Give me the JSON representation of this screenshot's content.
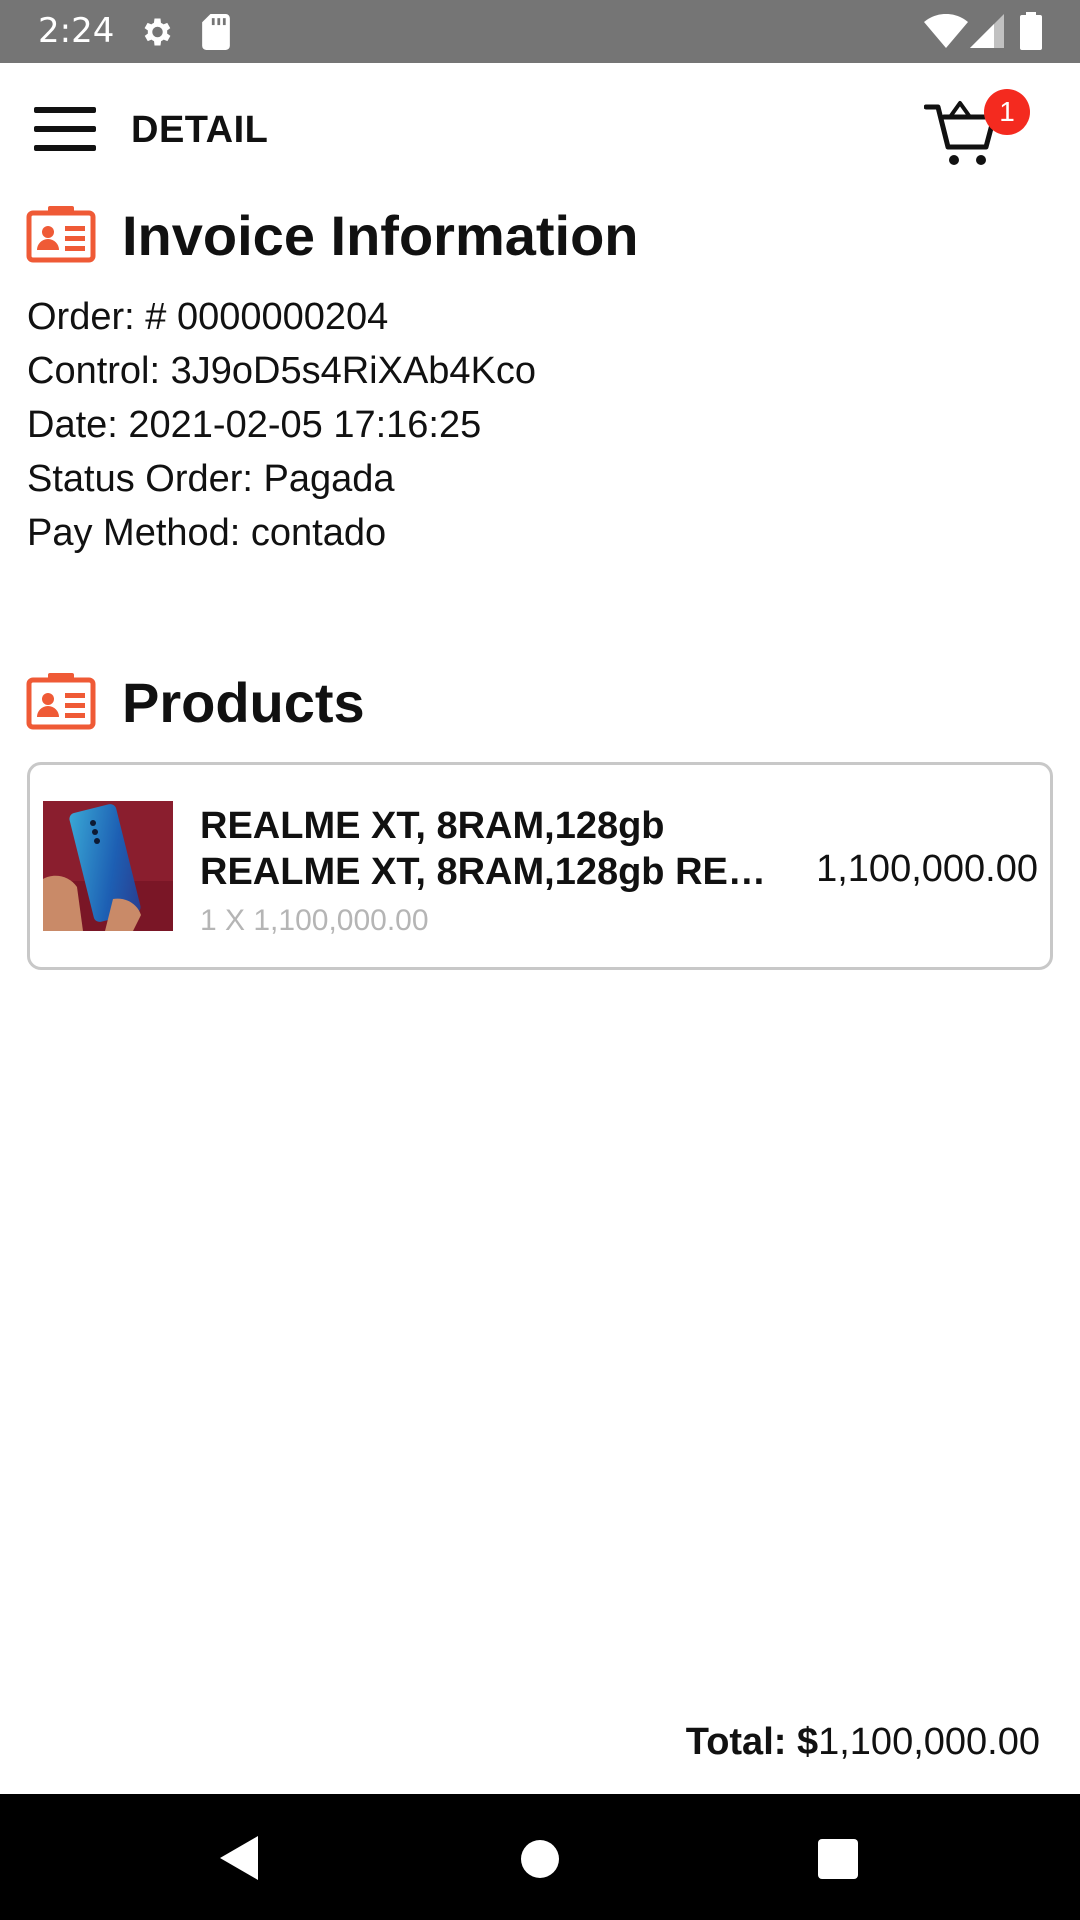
{
  "status_bar": {
    "time": "2:24",
    "icons": [
      "gear-icon",
      "sd-card-icon",
      "wifi-icon",
      "signal-icon",
      "battery-icon"
    ]
  },
  "app_bar": {
    "title": "DETAIL",
    "menu_icon": "hamburger-menu-icon",
    "cart_icon": "shopping-cart-icon",
    "cart_badge_count": "1"
  },
  "colors": {
    "accent": "#ef5a36",
    "badge": "#f42a1f",
    "status_bar": "#757575",
    "nav_bar": "#000000",
    "card_border": "#c8c8c8",
    "muted_text": "#b5b5b5"
  },
  "invoice": {
    "section_title": "Invoice Information",
    "section_icon": "id-card-icon",
    "lines": {
      "order": "Order: # 0000000204",
      "control": "Control: 3J9oD5s4RiXAb4Kco",
      "date": "Date: 2021-02-05 17:16:25",
      "status": "Status Order: Pagada",
      "pay_method": "Pay Method: contado"
    }
  },
  "products": {
    "section_title": "Products",
    "section_icon": "id-card-icon",
    "items": [
      {
        "name": "REALME XT, 8RAM,128gb",
        "description": "REALME XT, 8RAM,128gb RE…",
        "quantity_line": "1 X 1,100,000.00",
        "price": "1,100,000.00"
      }
    ]
  },
  "total": {
    "label": "Total:",
    "currency": "$",
    "amount": "1,100,000.00"
  },
  "nav_bar": {
    "icons": [
      "back-icon",
      "home-icon",
      "recents-icon"
    ]
  }
}
